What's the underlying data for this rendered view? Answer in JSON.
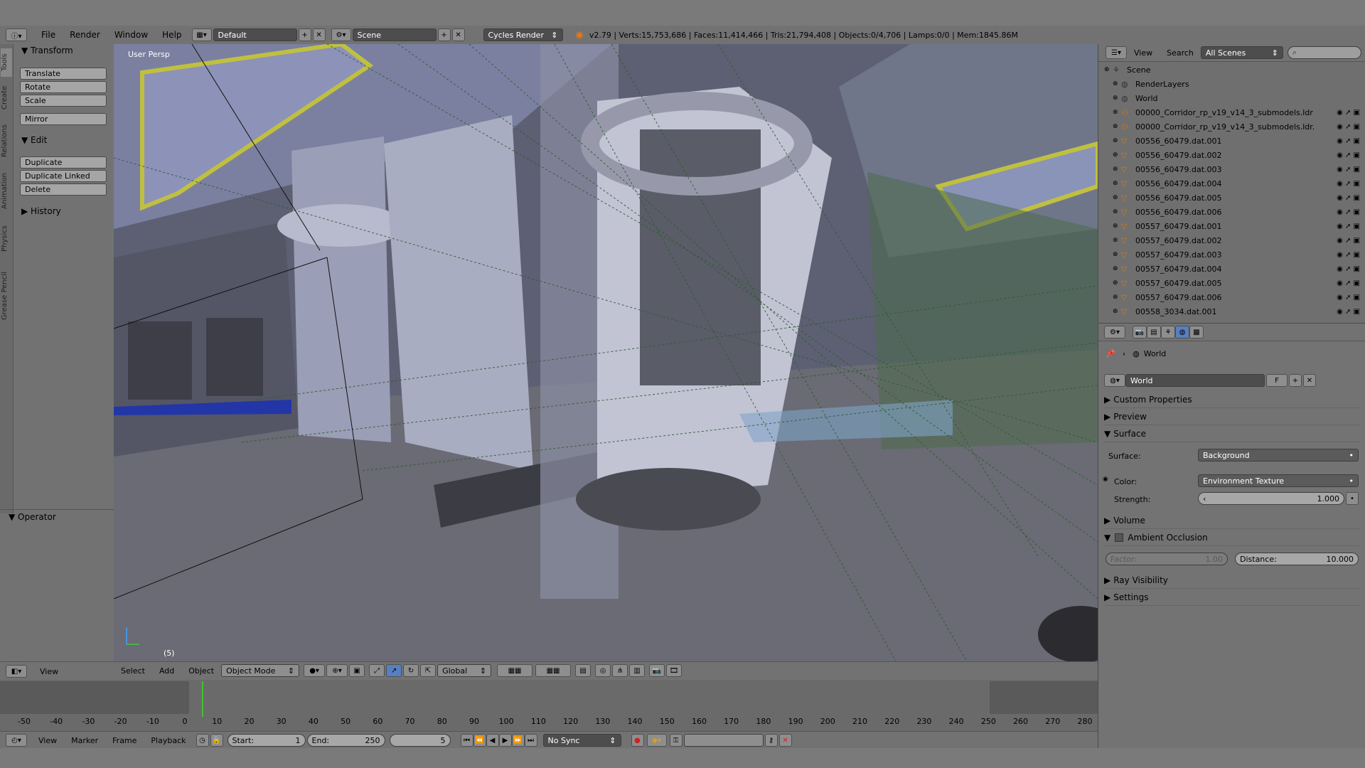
{
  "topbar": {
    "menus": [
      "File",
      "Render",
      "Window",
      "Help"
    ],
    "layout": "Default",
    "scene": "Scene",
    "engine": "Cycles Render",
    "stats": "v2.79 | Verts:15,753,686 | Faces:11,414,466 | Tris:21,794,408 | Objects:0/4,706 | Lamps:0/0 | Mem:1845.86M"
  },
  "toolshelf": {
    "tabs": [
      "Tools",
      "Create",
      "Relations",
      "Animation",
      "Physics",
      "Grease Pencil"
    ],
    "transform_header": "Transform",
    "transform_buttons": [
      "Translate",
      "Rotate",
      "Scale",
      "Mirror"
    ],
    "edit_header": "Edit",
    "edit_buttons": [
      "Duplicate",
      "Duplicate Linked",
      "Delete"
    ],
    "history_header": "History",
    "operator_header": "Operator"
  },
  "viewport": {
    "label": "User Persp",
    "frame_indicator": "(5)"
  },
  "viewport_header": {
    "menus": [
      "View",
      "Select",
      "Add",
      "Object"
    ],
    "mode": "Object Mode",
    "orientation": "Global"
  },
  "outliner": {
    "menus": [
      "View",
      "Search"
    ],
    "display": "All Scenes",
    "items": [
      {
        "name": "Scene",
        "indent": 0
      },
      {
        "name": "RenderLayers",
        "indent": 1
      },
      {
        "name": "World",
        "indent": 1
      },
      {
        "name": "00000_Corridor_rp_v19_v14_3_submodels.ldr",
        "indent": 1
      },
      {
        "name": "00000_Corridor_rp_v19_v14_3_submodels.ldr.",
        "indent": 1
      },
      {
        "name": "00556_60479.dat.001",
        "indent": 1
      },
      {
        "name": "00556_60479.dat.002",
        "indent": 1
      },
      {
        "name": "00556_60479.dat.003",
        "indent": 1
      },
      {
        "name": "00556_60479.dat.004",
        "indent": 1
      },
      {
        "name": "00556_60479.dat.005",
        "indent": 1
      },
      {
        "name": "00556_60479.dat.006",
        "indent": 1
      },
      {
        "name": "00557_60479.dat.001",
        "indent": 1
      },
      {
        "name": "00557_60479.dat.002",
        "indent": 1
      },
      {
        "name": "00557_60479.dat.003",
        "indent": 1
      },
      {
        "name": "00557_60479.dat.004",
        "indent": 1
      },
      {
        "name": "00557_60479.dat.005",
        "indent": 1
      },
      {
        "name": "00557_60479.dat.006",
        "indent": 1
      },
      {
        "name": "00558_3034.dat.001",
        "indent": 1
      }
    ]
  },
  "properties": {
    "breadcrumb": "World",
    "world_name": "World",
    "fake_user": "F",
    "panels": {
      "custom_properties": "Custom Properties",
      "preview": "Preview",
      "surface": "Surface",
      "volume": "Volume",
      "ambient_occlusion": "Ambient Occlusion",
      "ray_visibility": "Ray Visibility",
      "settings": "Settings"
    },
    "surface_label": "Surface:",
    "surface_value": "Background",
    "color_label": "Color:",
    "color_value": "Environment Texture",
    "strength_label": "Strength:",
    "strength_value": "1.000",
    "factor_label": "Factor:",
    "factor_value": "1.00",
    "distance_label": "Distance:",
    "distance_value": "10.000"
  },
  "timeline": {
    "ticks": [
      "-50",
      "-40",
      "-30",
      "-20",
      "-10",
      "0",
      "10",
      "20",
      "30",
      "40",
      "50",
      "60",
      "70",
      "80",
      "90",
      "100",
      "110",
      "120",
      "130",
      "140",
      "150",
      "160",
      "170",
      "180",
      "190",
      "200",
      "210",
      "220",
      "230",
      "240",
      "250",
      "260",
      "270",
      "280"
    ],
    "menus": [
      "View",
      "Marker",
      "Frame",
      "Playback"
    ],
    "start_label": "Start:",
    "start_value": "1",
    "end_label": "End:",
    "end_value": "250",
    "current_frame": "5",
    "sync": "No Sync"
  },
  "colors": {
    "panel_bg": "#727272",
    "viewport_bg": "#5d6070",
    "accent_blue": "#5680c2",
    "current_frame_green": "#43c12e"
  }
}
